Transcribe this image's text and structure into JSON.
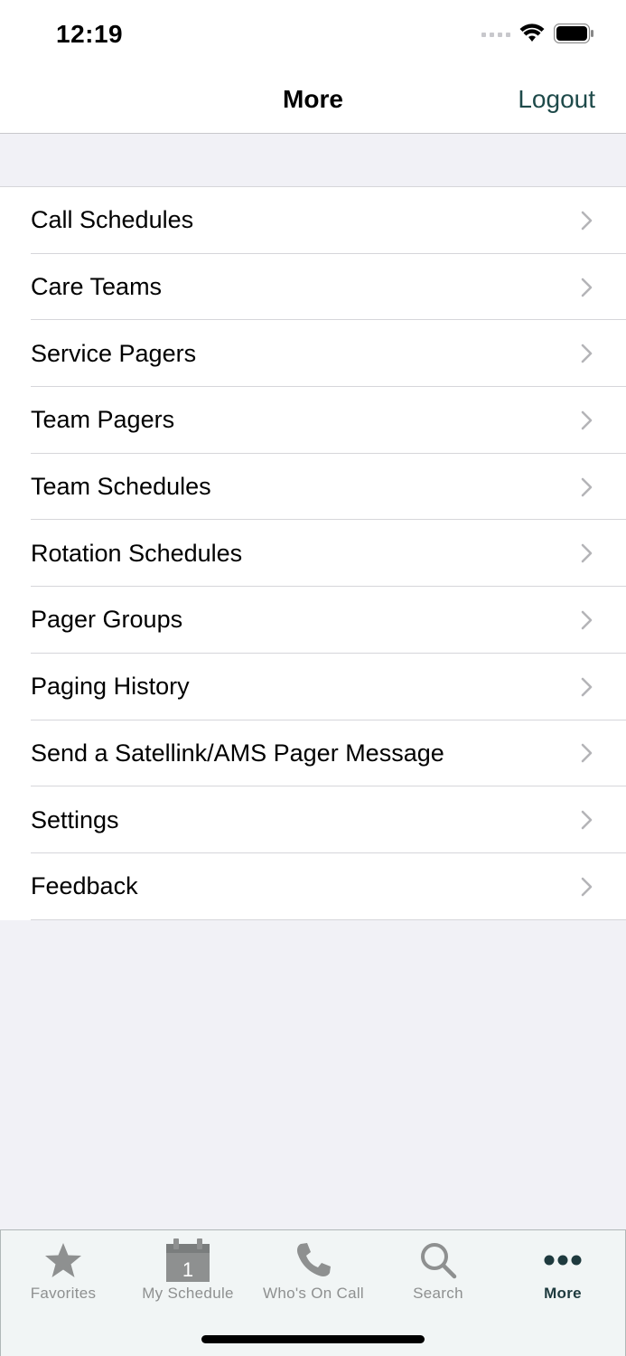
{
  "status_bar": {
    "time": "12:19"
  },
  "nav": {
    "title": "More",
    "logout_label": "Logout"
  },
  "menu": {
    "items": [
      {
        "label": "Call Schedules"
      },
      {
        "label": "Care Teams"
      },
      {
        "label": "Service Pagers"
      },
      {
        "label": "Team Pagers"
      },
      {
        "label": "Team Schedules"
      },
      {
        "label": "Rotation Schedules"
      },
      {
        "label": "Pager Groups"
      },
      {
        "label": "Paging History"
      },
      {
        "label": "Send a Satellink/AMS Pager Message"
      },
      {
        "label": "Settings"
      },
      {
        "label": "Feedback"
      }
    ]
  },
  "tab_bar": {
    "active": "More",
    "calendar_day": "1",
    "tabs": [
      {
        "label": "Favorites",
        "icon": "star-icon"
      },
      {
        "label": "My Schedule",
        "icon": "calendar-icon"
      },
      {
        "label": "Who's On Call",
        "icon": "phone-icon"
      },
      {
        "label": "Search",
        "icon": "search-icon"
      },
      {
        "label": "More",
        "icon": "more-dots-icon"
      }
    ]
  },
  "colors": {
    "accent": "#1e4a4a",
    "inactive_tab": "#8e9090",
    "background": "#f1f1f6"
  }
}
